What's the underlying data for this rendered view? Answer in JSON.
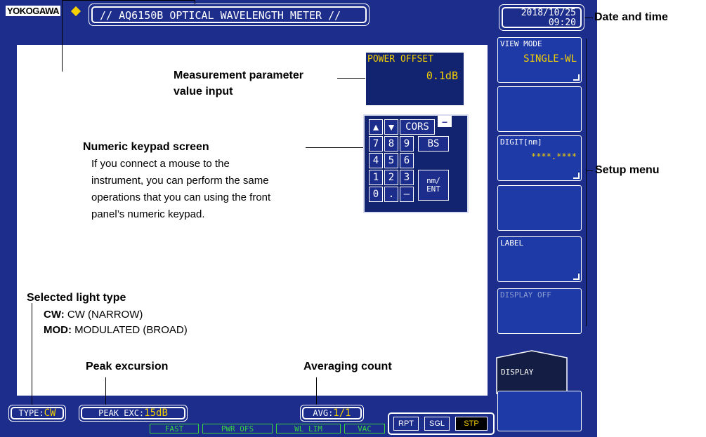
{
  "header": {
    "logo": "YOKOGAWA",
    "title": "// AQ6150B OPTICAL WAVELENGTH METER //",
    "date": "2018/10/25",
    "time": "09:20"
  },
  "power_offset": {
    "label": "POWER OFFSET",
    "value": "0.1dB"
  },
  "keypad": {
    "up": "▲",
    "down": "▼",
    "cors": "CORS",
    "minus_top": "–",
    "bs": "BS",
    "digits": [
      "7",
      "8",
      "9",
      "4",
      "5",
      "6",
      "1",
      "2",
      "3",
      "0",
      ".",
      "–"
    ],
    "enter_line1": "nm/",
    "enter_line2": "ENT"
  },
  "menu": {
    "items": [
      {
        "label": "VIEW MODE",
        "value": "SINGLE-WL"
      },
      {
        "label": "",
        "value": ""
      },
      {
        "label": "DIGIT[nm]",
        "value": "****.****"
      },
      {
        "label": "",
        "value": ""
      },
      {
        "label": "LABEL",
        "value": ""
      },
      {
        "label": "DISPLAY OFF",
        "value": ""
      }
    ],
    "display_tab": "DISPLAY"
  },
  "status": {
    "type_label": "TYPE:",
    "type_value": "CW",
    "peak_label": "PEAK EXC:",
    "peak_value": "15dB",
    "avg_label": "AVG:",
    "avg_value": "1/1",
    "indicators": [
      "FAST",
      "PWR OFS",
      "WL LIM",
      "VAC"
    ],
    "rpt": "RPT",
    "sgl": "SGL",
    "stp": "STP"
  },
  "annotations": {
    "date_time": "Date and time",
    "param_input_1": "Measurement parameter",
    "param_input_2": "value input",
    "keypad_title": "Numeric keypad screen",
    "keypad_desc_1": "If you connect a mouse to the",
    "keypad_desc_2": "instrument, you can perform the same",
    "keypad_desc_3": "operations that you can using the front",
    "keypad_desc_4": "panel’s numeric keypad.",
    "setup_menu": "Setup menu",
    "light_type": "Selected light type",
    "cw_key": "CW:",
    "cw_desc": " CW (NARROW)",
    "mod_key": "MOD:",
    "mod_desc": " MODULATED (BROAD)",
    "peak_excursion": "Peak excursion",
    "averaging_count": "Averaging count"
  },
  "colors": {
    "screen_bg": "#1c2d8c",
    "accent_yellow": "#f5d000",
    "indicator_green": "#3bd33b"
  }
}
